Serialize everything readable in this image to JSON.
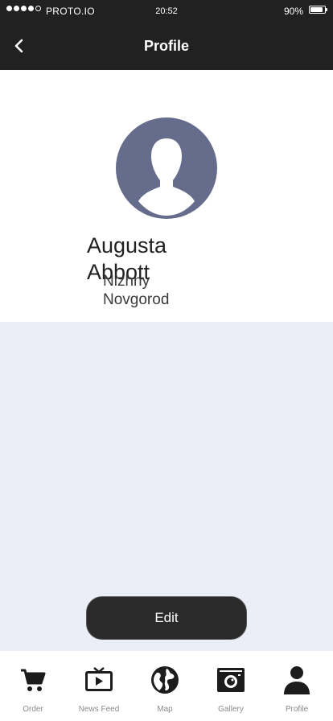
{
  "status_bar": {
    "carrier": "PROTO.IO",
    "time": "20:52",
    "battery": "90%",
    "battery_level": 0.9,
    "signal_filled": 4,
    "signal_total": 5
  },
  "header": {
    "title": "Profile",
    "back_icon": "chevron-left-icon"
  },
  "profile": {
    "avatar_icon": "user-silhouette-icon",
    "name": "Augusta Abbott",
    "city": "Nizhny Novgorod"
  },
  "edit_label": "Edit",
  "tabs": [
    {
      "label": "Order",
      "icon": "cart-icon"
    },
    {
      "label": "News Feed",
      "icon": "tv-icon"
    },
    {
      "label": "Map",
      "icon": "globe-icon"
    },
    {
      "label": "Gallery",
      "icon": "camera-icon"
    },
    {
      "label": "Profile",
      "icon": "person-icon"
    }
  ],
  "colors": {
    "bar_background": "#212121",
    "page_background": "#ebeef6",
    "avatar_background": "#666d8c",
    "button_background": "#2a2a2a"
  }
}
